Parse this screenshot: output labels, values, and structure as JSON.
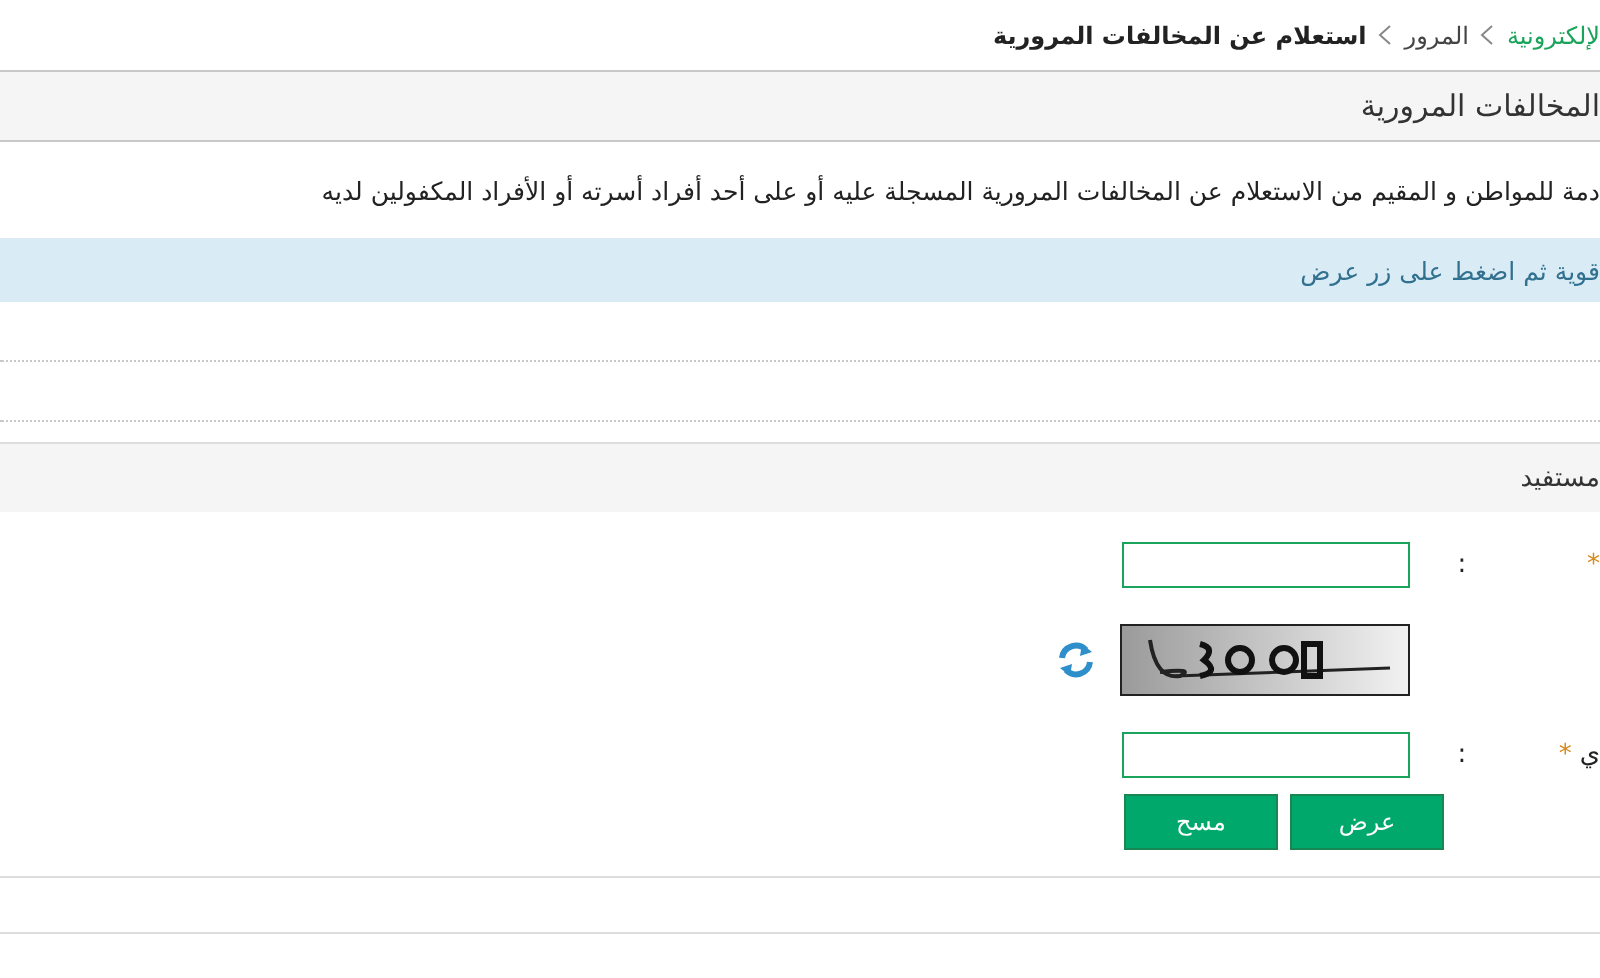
{
  "breadcrumb": [
    {
      "label": "لإلكترونية",
      "kind": "link"
    },
    {
      "label": "المرور",
      "kind": "link"
    },
    {
      "label": "استعلام عن المخالفات المرورية",
      "kind": "current"
    }
  ],
  "section_title": "المخالفات المرورية",
  "description": "دمة للمواطن و المقيم من الاستعلام عن المخالفات المرورية المسجلة عليه أو على أحد أفراد أسرته أو الأفراد المكفولين لديه",
  "info": "قوية ثم اضغط على زر عرض",
  "form_title": "مستفيد",
  "fields": [
    {
      "kind": "input",
      "required_mark": "*",
      "colon": ":"
    },
    {
      "kind": "captcha"
    },
    {
      "kind": "input",
      "label": "ي",
      "required_mark": "*",
      "colon": ":"
    }
  ],
  "buttons": [
    {
      "label": "عرض"
    },
    {
      "label": "مسح"
    }
  ]
}
